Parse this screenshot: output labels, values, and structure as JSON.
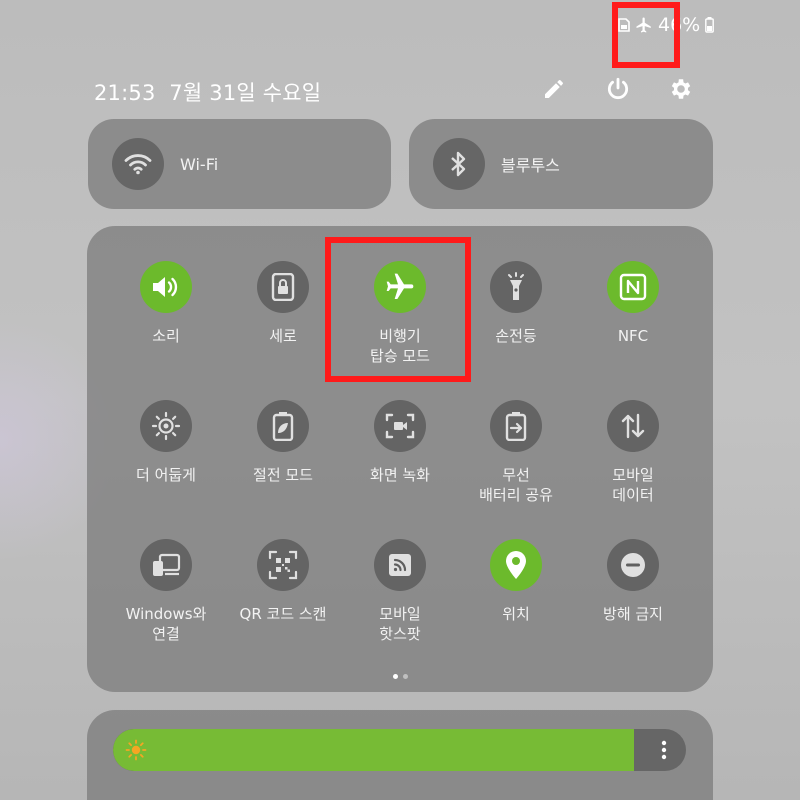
{
  "status_bar": {
    "battery_text": "46%",
    "icons": [
      "sim-icon",
      "airplane-icon",
      "battery-icon"
    ]
  },
  "header": {
    "time": "21:53",
    "date": "7월 31일 수요일",
    "icons": [
      "edit-icon",
      "power-icon",
      "settings-icon"
    ]
  },
  "top_tiles": [
    {
      "label": "Wi-Fi",
      "icon": "wifi-icon"
    },
    {
      "label": "블루투스",
      "icon": "bluetooth-icon"
    }
  ],
  "tiles": [
    {
      "label": "소리",
      "icon": "sound-icon",
      "active": true
    },
    {
      "label": "세로",
      "icon": "portrait-lock-icon",
      "active": false
    },
    {
      "label": "비행기\n탑승 모드",
      "icon": "airplane-icon",
      "active": true
    },
    {
      "label": "손전등",
      "icon": "flashlight-icon",
      "active": false
    },
    {
      "label": "NFC",
      "icon": "nfc-icon",
      "active": true
    },
    {
      "label": "더 어둡게",
      "icon": "extra-dim-icon",
      "active": false
    },
    {
      "label": "절전 모드",
      "icon": "power-saving-icon",
      "active": false
    },
    {
      "label": "화면 녹화",
      "icon": "screen-record-icon",
      "active": false
    },
    {
      "label": "무선\n배터리 공유",
      "icon": "battery-share-icon",
      "active": false
    },
    {
      "label": "모바일\n데이터",
      "icon": "mobile-data-icon",
      "active": false
    },
    {
      "label": "Windows와\n연결",
      "icon": "link-windows-icon",
      "active": false
    },
    {
      "label": "QR 코드 스캔",
      "icon": "qr-scan-icon",
      "active": false
    },
    {
      "label": "모바일\n핫스팟",
      "icon": "hotspot-icon",
      "active": false
    },
    {
      "label": "위치",
      "icon": "location-icon",
      "active": true
    },
    {
      "label": "방해 금지",
      "icon": "do-not-disturb-icon",
      "active": false
    }
  ],
  "pager": {
    "pages": 2,
    "current": 1
  },
  "brightness": {
    "level": 0.91,
    "icons": [
      "sun-icon",
      "more-options-icon"
    ]
  },
  "colors": {
    "accent_on": "#6cba2c",
    "highlight": "#ff1a1a",
    "tile_off": "#5f5f5f"
  }
}
